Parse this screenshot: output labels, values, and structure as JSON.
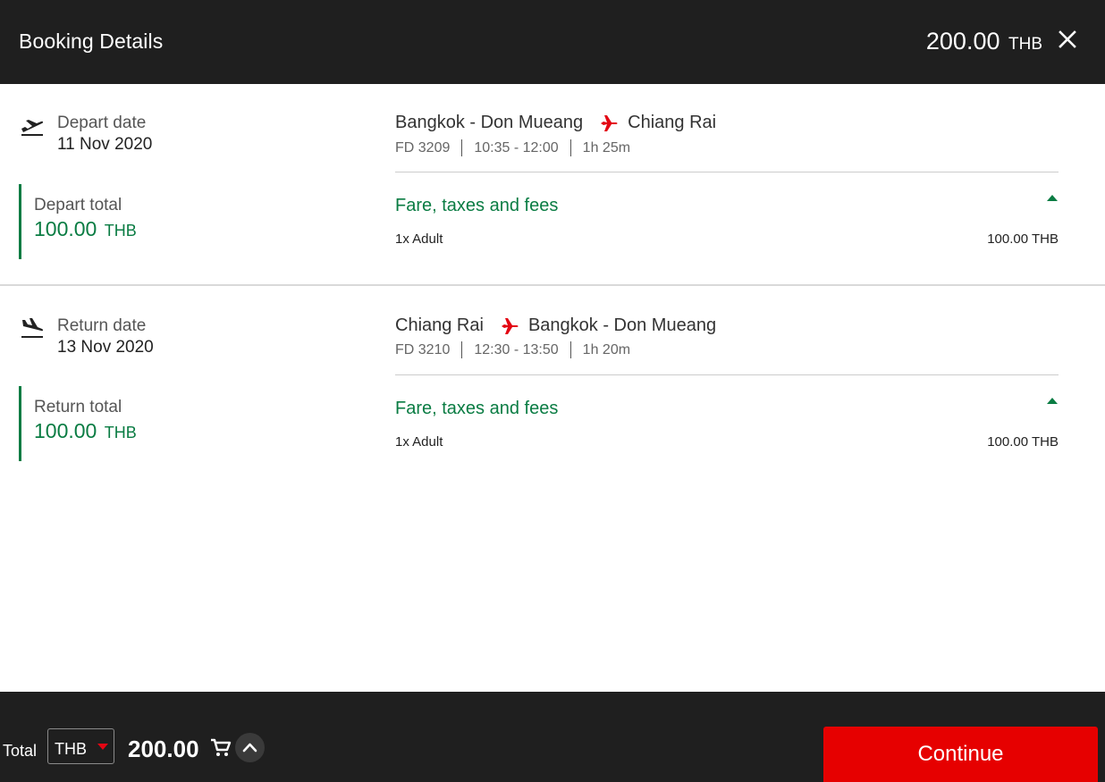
{
  "header": {
    "title": "Booking Details",
    "total_amount": "200.00",
    "total_currency": "THB"
  },
  "depart": {
    "label": "Depart date",
    "date": "11 Nov 2020",
    "total_label": "Depart total",
    "total_amount": "100.00",
    "total_currency": "THB",
    "origin": "Bangkok - Don Mueang",
    "destination": "Chiang Rai",
    "flight_no": "FD 3209",
    "times": "10:35 - 12:00",
    "duration": "1h 25m",
    "fare_label": "Fare, taxes and fees",
    "pax": "1x Adult",
    "pax_price": "100.00 THB"
  },
  "return": {
    "label": "Return date",
    "date": "13 Nov 2020",
    "total_label": "Return total",
    "total_amount": "100.00",
    "total_currency": "THB",
    "origin": "Chiang Rai",
    "destination": "Bangkok - Don Mueang",
    "flight_no": "FD 3210",
    "times": "12:30 - 13:50",
    "duration": "1h 20m",
    "fare_label": "Fare, taxes and fees",
    "pax": "1x Adult",
    "pax_price": "100.00 THB"
  },
  "footer": {
    "total_label": "Total",
    "currency": "THB",
    "amount": "200.00",
    "continue_label": "Continue"
  },
  "icons": {
    "close": "close-icon",
    "takeoff": "plane-takeoff-icon",
    "landing": "plane-landing-icon",
    "route": "airplane-icon",
    "fare_toggle": "caret-up-icon",
    "cart": "cart-icon",
    "expand": "chevron-up-icon",
    "currency_dropdown": "caret-down-icon"
  },
  "colors": {
    "header_bg": "#1f1f1f",
    "accent_green": "#0a7c43",
    "brand_red": "#e60000"
  }
}
